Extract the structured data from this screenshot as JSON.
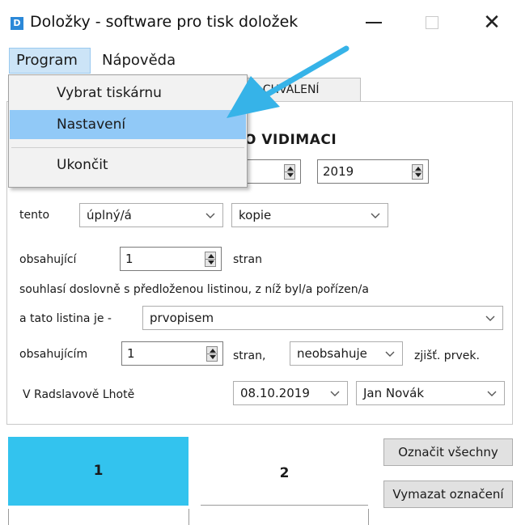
{
  "window": {
    "title": "Doložky - software pro tisk doložek",
    "icon_letter": "D",
    "close_glyph": "✕"
  },
  "menubar": {
    "program": "Program",
    "help": "Nápověda"
  },
  "program_menu": {
    "items": [
      "Vybrat tiskárnu",
      "Nastavení",
      "Ukončit"
    ],
    "highlighted": "Nastavení"
  },
  "tabs": {
    "visible_fragment": "ÉP  CHVÁLENÍ"
  },
  "panel": {
    "heading_fragment": "O VIDIMACI",
    "year": "2019",
    "row_tento": {
      "label": "tento",
      "completeness": "úplný/á",
      "doc_kind": "kopie"
    },
    "row_pages": {
      "label": "obsahující",
      "count": "1",
      "suffix": "stran"
    },
    "sentence": "souhlasí doslovně s předloženou listinou, z níž byl/a pořízen/a",
    "row_original": {
      "label": "a tato listina je -",
      "value": "prvopisem"
    },
    "row_pages2": {
      "label": "obsahujícím",
      "count": "1",
      "suffix": "stran,",
      "contains": "neobsahuje",
      "tail": "zjišť. prvek."
    },
    "row_place": {
      "place": "V Radslavově Lhotě",
      "date": "08.10.2019",
      "person": "Jan Novák"
    }
  },
  "bottom": {
    "page1": "1",
    "page2": "2",
    "select_all": "Označit všechny",
    "clear_selection": "Vymazat označení"
  },
  "colors": {
    "accent_arrow": "#36b3e8",
    "menu_highlight": "#91c9f7",
    "page_selected": "#33c3ee"
  }
}
